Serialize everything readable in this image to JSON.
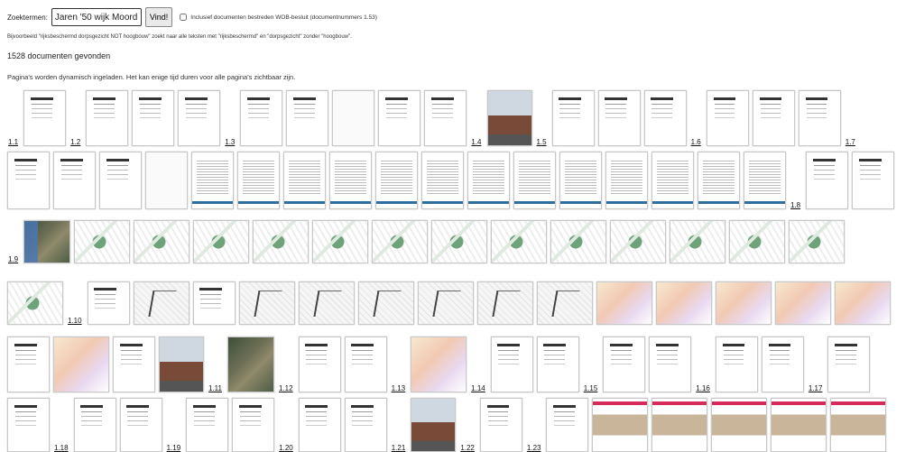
{
  "search": {
    "label": "Zoektermen:",
    "value": "Jaren '50 wijk Moordrecht",
    "button": "Vind!",
    "checkbox_label": "Inclusief documenten bestreden WOB-besluit (documentnummers 1.53)",
    "checkbox_checked": false
  },
  "example_text": "Bijvoorbeeld \"rijksbeschermd dorpsgezicht NOT hoogbouw\" zoekt naar alle teksten met \"rijksbeschermd\" en \"dorpsgezicht\" zonder \"hoogbouw\".",
  "result_count": "1528 documenten gevonden",
  "loading_note": "Pagina's worden dynamisch ingeladen. Het kan enige tijd duren voor alle pagina's zichtbaar zijn.",
  "rows": [
    {
      "items": [
        {
          "label": "1.1"
        },
        {
          "t": "doc"
        },
        {
          "label": "1.2"
        },
        {
          "t": "doc"
        },
        {
          "t": "doc"
        },
        {
          "t": "doc"
        },
        {
          "label": "1.3"
        },
        {
          "t": "doc"
        },
        {
          "t": "doc"
        },
        {
          "t": "blank"
        },
        {
          "t": "doc"
        },
        {
          "t": "doc"
        },
        {
          "label": "1.4"
        },
        {
          "t": "photo"
        },
        {
          "label": "1.5"
        },
        {
          "t": "doc"
        },
        {
          "t": "doc"
        },
        {
          "t": "doc"
        },
        {
          "label": "1.6"
        },
        {
          "t": "doc"
        },
        {
          "t": "doc"
        },
        {
          "t": "doc"
        },
        {
          "label": "1.7"
        }
      ]
    },
    {
      "items": [
        {
          "t": "doc"
        },
        {
          "t": "doc"
        },
        {
          "t": "doc"
        },
        {
          "t": "blank"
        },
        {
          "t": "text"
        },
        {
          "t": "text"
        },
        {
          "t": "text"
        },
        {
          "t": "text"
        },
        {
          "t": "text"
        },
        {
          "t": "text"
        },
        {
          "t": "text"
        },
        {
          "t": "text"
        },
        {
          "t": "text"
        },
        {
          "t": "text"
        },
        {
          "t": "text"
        },
        {
          "t": "text"
        },
        {
          "t": "text"
        },
        {
          "label": "1.8"
        },
        {
          "t": "doc"
        },
        {
          "t": "doc"
        }
      ]
    },
    {
      "items": [
        {
          "label": "1.9"
        },
        {
          "t": "aerial"
        },
        {
          "t": "map"
        },
        {
          "t": "map"
        },
        {
          "t": "map"
        },
        {
          "t": "map"
        },
        {
          "t": "map"
        },
        {
          "t": "map"
        },
        {
          "t": "map"
        },
        {
          "t": "map"
        },
        {
          "t": "map"
        },
        {
          "t": "map"
        },
        {
          "t": "map"
        },
        {
          "t": "map"
        },
        {
          "t": "map"
        }
      ]
    },
    {
      "items": [
        {
          "t": "map"
        },
        {
          "label": "1.10"
        },
        {
          "t": "doc"
        },
        {
          "t": "plan"
        },
        {
          "t": "doc"
        },
        {
          "t": "plan"
        },
        {
          "t": "plan"
        },
        {
          "t": "plan"
        },
        {
          "t": "plan"
        },
        {
          "t": "plan"
        },
        {
          "t": "plan"
        },
        {
          "t": "color"
        },
        {
          "t": "color"
        },
        {
          "t": "color"
        },
        {
          "t": "color"
        },
        {
          "t": "color"
        }
      ]
    },
    {
      "items": [
        {
          "t": "doc"
        },
        {
          "t": "color"
        },
        {
          "t": "doc"
        },
        {
          "t": "photo"
        },
        {
          "label": "1.11"
        },
        {
          "t": "aerial"
        },
        {
          "label": "1.12"
        },
        {
          "t": "doc"
        },
        {
          "t": "doc"
        },
        {
          "label": "1.13"
        },
        {
          "t": "color"
        },
        {
          "label": "1.14"
        },
        {
          "t": "doc"
        },
        {
          "t": "doc"
        },
        {
          "label": "1.15"
        },
        {
          "t": "doc"
        },
        {
          "t": "doc"
        },
        {
          "label": "1.16"
        },
        {
          "t": "doc"
        },
        {
          "t": "doc"
        },
        {
          "label": "1.17"
        },
        {
          "t": "doc"
        }
      ]
    },
    {
      "items": [
        {
          "t": "doc"
        },
        {
          "label": "1.18"
        },
        {
          "t": "doc"
        },
        {
          "t": "doc"
        },
        {
          "label": "1.19"
        },
        {
          "t": "doc"
        },
        {
          "t": "doc"
        },
        {
          "label": "1.20"
        },
        {
          "t": "doc"
        },
        {
          "t": "doc"
        },
        {
          "label": "1.21"
        },
        {
          "t": "photo"
        },
        {
          "label": "1.22"
        },
        {
          "t": "doc"
        },
        {
          "label": "1.23"
        },
        {
          "t": "doc"
        },
        {
          "t": "redhead"
        },
        {
          "t": "redhead"
        },
        {
          "t": "redhead"
        },
        {
          "t": "redhead"
        },
        {
          "t": "redhead"
        }
      ]
    }
  ]
}
